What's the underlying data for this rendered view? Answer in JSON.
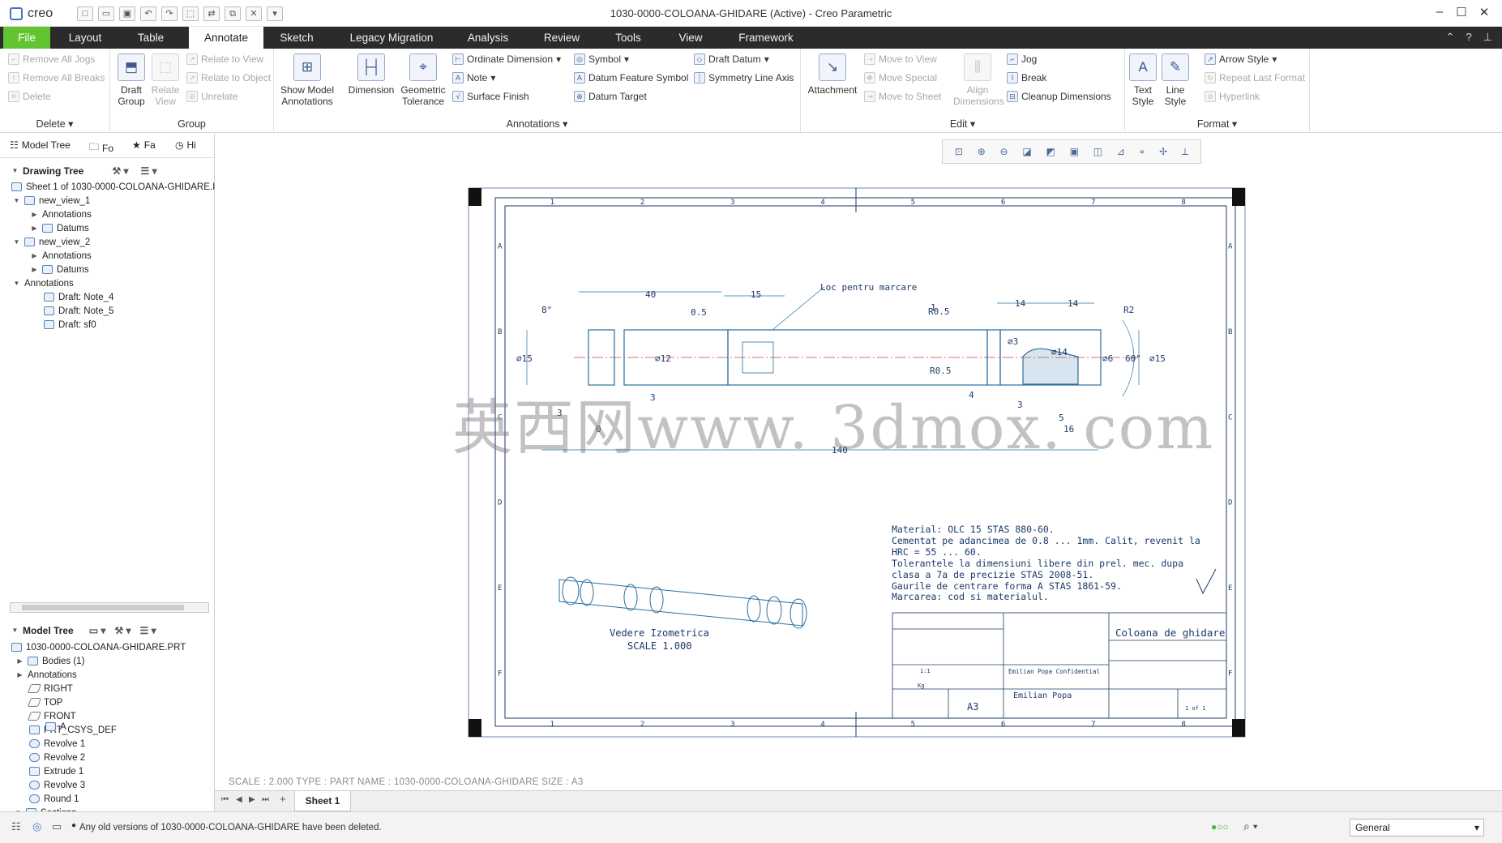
{
  "app": {
    "name": "creo",
    "window_title": "1030-0000-COLOANA-GHIDARE (Active) - Creo Parametric"
  },
  "tabs": [
    "File",
    "Layout",
    "Table",
    "Annotate",
    "Sketch",
    "Legacy Migration",
    "Analysis",
    "Review",
    "Tools",
    "View",
    "Framework"
  ],
  "ribbon": {
    "delete_group": {
      "label": "Delete",
      "items": [
        "Remove All Jogs",
        "Remove All Breaks",
        "Delete"
      ]
    },
    "group_group": {
      "label": "Group",
      "draft_group": "Draft Group",
      "relate_view": "Relate View",
      "relate_to_view": "Relate to View",
      "relate_to_object": "Relate to Object",
      "unrelate": "Unrelate"
    },
    "annotations_group": {
      "label": "Annotations",
      "show_model": "Show Model Annotations",
      "dimension": "Dimension",
      "geometric_tolerance": "Geometric Tolerance",
      "ordinate_dimension": "Ordinate Dimension",
      "note": "Note",
      "surface_finish": "Surface Finish",
      "symbol": "Symbol",
      "datum_feature_symbol": "Datum Feature Symbol",
      "datum_target": "Datum Target",
      "draft_datum": "Draft Datum",
      "symmetry_line_axis": "Symmetry Line Axis"
    },
    "edit_group": {
      "label": "Edit",
      "attachment": "Attachment",
      "move_to_view": "Move to View",
      "move_special": "Move Special",
      "move_to_sheet": "Move to Sheet",
      "align_dimensions": "Align Dimensions",
      "jog": "Jog",
      "break": "Break",
      "cleanup_dimensions": "Cleanup Dimensions"
    },
    "format_group": {
      "label": "Format",
      "text_style": "Text Style",
      "line_style": "Line Style",
      "arrow_style": "Arrow Style",
      "repeat_last_format": "Repeat Last Format",
      "hyperlink": "Hyperlink"
    }
  },
  "panel": {
    "tabs": [
      "Model Tree",
      "Fo",
      "Fa",
      "Hi"
    ],
    "drawing_tree": {
      "title": "Drawing Tree",
      "rows": [
        "Sheet 1 of 1030-0000-COLOANA-GHIDARE.I",
        "new_view_1",
        "Annotations",
        "Datums",
        "new_view_2",
        "Annotations",
        "Datums",
        "Annotations",
        "Draft: Note_4",
        "Draft: Note_5",
        "Draft: sf0"
      ]
    },
    "model_tree": {
      "title": "Model Tree",
      "rows": [
        "1030-0000-COLOANA-GHIDARE.PRT",
        "Bodies (1)",
        "Annotations",
        "RIGHT",
        "TOP",
        "FRONT",
        "PRT_CSYS_DEF",
        "Revolve 1",
        "Revolve 2",
        "Extrude 1",
        "Revolve 3",
        "Round 1",
        "Sections",
        "A"
      ]
    }
  },
  "drawing": {
    "zone_cols": [
      "1",
      "2",
      "3",
      "4",
      "5",
      "6",
      "7",
      "8"
    ],
    "zone_rows": [
      "A",
      "B",
      "C",
      "D",
      "E",
      "F"
    ],
    "dims": {
      "d40": "40",
      "d15": "15",
      "d05": "0.5",
      "note": "Loc pentru marcare",
      "r05": "R0.5",
      "d14a": "14",
      "d14b": "14",
      "r2": "R2",
      "d1": "1",
      "ang8": "8°",
      "phi15": "⌀15",
      "phi12": "⌀12",
      "d3a": "3",
      "d3b": "3",
      "d140": "140",
      "r05b": "R0.5",
      "d4": "4",
      "phi3": "⌀3",
      "phi14": "⌀14",
      "phi6": "⌀6",
      "ang60": "60°",
      "phi15b": "⌀15",
      "d3c": "3",
      "d5": "5",
      "d16": "16",
      "d0": "0"
    },
    "notes": [
      "Material: OLC 15 STAS 880-60.",
      "Cementat pe adancimea de 0.8 ... 1mm. Calit, revenit la",
      "HRC = 55 ... 60.",
      "Tolerantele la dimensiuni libere din prel. mec. dupa",
      "clasa a 7a de precizie STAS 2008-51.",
      "Gaurile de centrare forma A STAS 1861-59.",
      "Marcarea: cod si materialul."
    ],
    "iso_label": "Vedere Izometrica",
    "iso_scale": "SCALE 1.000",
    "title_block": {
      "part_name": "Coloana de ghidare",
      "confidential": "Emilian Popa Confidential",
      "author": "Emilian Popa",
      "size": "A3",
      "scale": "1:1",
      "weight": "Kg",
      "sheet": "1 of 1"
    }
  },
  "watermark": "英西网www. 3dmox. com",
  "sheet_info": "SCALE : 2.000     TYPE : PART     NAME : 1030-0000-COLOANA-GHIDARE     SIZE : A3",
  "sheet_tab": "Sheet 1",
  "status": {
    "message": "Any old versions of 1030-0000-COLOANA-GHIDARE have been deleted.",
    "filter": "General"
  },
  "colors": {
    "file_tab": "#62c431",
    "tab_bar": "#2b2b2b",
    "drawing_line": "#1a3a6a",
    "part_line": "#2a6fa0"
  }
}
